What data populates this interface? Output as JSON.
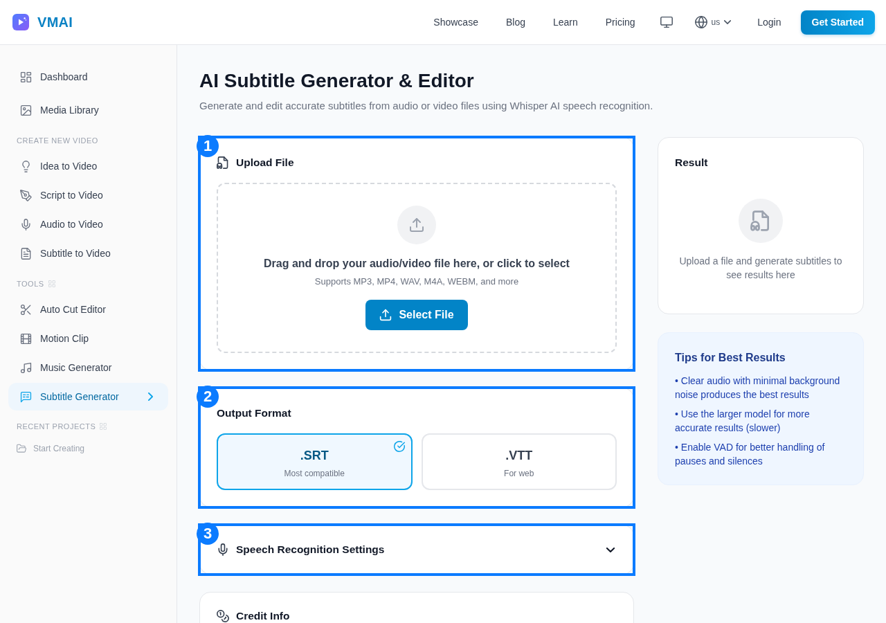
{
  "header": {
    "brand": "VMAI",
    "nav": [
      {
        "label": "Showcase"
      },
      {
        "label": "Blog"
      },
      {
        "label": "Learn"
      },
      {
        "label": "Pricing"
      }
    ],
    "language": "us",
    "login": "Login",
    "get_started": "Get Started"
  },
  "sidebar": {
    "items": [
      {
        "label": "Dashboard",
        "selected": false
      },
      {
        "label": "Media Library",
        "selected": false
      }
    ],
    "sections": [
      {
        "heading": "CREATE NEW VIDEO",
        "view_toggle": false,
        "items": [
          {
            "label": "Idea to Video",
            "selected": false
          },
          {
            "label": "Script to Video",
            "selected": false
          },
          {
            "label": "Audio to Video",
            "selected": false
          },
          {
            "label": "Subtitle to Video",
            "selected": false
          }
        ]
      },
      {
        "heading": "TOOLS",
        "view_toggle": true,
        "items": [
          {
            "label": "Auto Cut Editor",
            "selected": false
          },
          {
            "label": "Motion Clip",
            "selected": false
          },
          {
            "label": "Music Generator",
            "selected": false
          },
          {
            "label": "Subtitle Generator",
            "selected": true
          }
        ]
      }
    ],
    "recent_projects": {
      "heading": "RECENT PROJECTS",
      "view_toggle": true,
      "items": [
        {
          "label": "Start Creating"
        }
      ]
    }
  },
  "page": {
    "title": "AI Subtitle Generator & Editor",
    "subtitle": "Generate and edit accurate subtitles from audio or video files using Whisper AI speech recognition."
  },
  "upload_card": {
    "annotation": "1",
    "title": "Upload File",
    "prompt": "Drag and drop your audio/video file here, or click to select",
    "formats": "Supports MP3, MP4, WAV, M4A, WEBM, and more",
    "button": "Select File"
  },
  "output_format_card": {
    "annotation": "2",
    "title": "Output Format",
    "options": [
      {
        "label": ".SRT",
        "caption": "Most compatible",
        "selected": true
      },
      {
        "label": ".VTT",
        "caption": "For web",
        "selected": false
      }
    ]
  },
  "speech_settings_card": {
    "annotation": "3",
    "title": "Speech Recognition Settings",
    "expanded": false
  },
  "credit_info_card": {
    "title": "Credit Info"
  },
  "result_card": {
    "title": "Result",
    "empty_message": "Upload a file and generate subtitles to see results here"
  },
  "tips_card": {
    "title": "Tips for Best Results",
    "tips": [
      "• Clear audio with minimal background noise produces the best results",
      "• Use the larger model for more accurate results (slower)",
      "• Enable VAD for better handling of pauses and silences"
    ]
  }
}
